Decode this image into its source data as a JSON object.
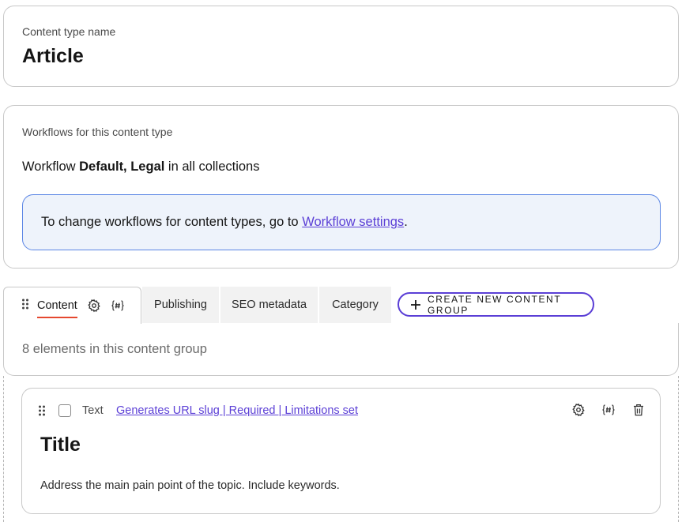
{
  "content_type": {
    "label": "Content type name",
    "name": "Article"
  },
  "workflows": {
    "label": "Workflows for this content type",
    "prefix": "Workflow",
    "names": "Default, Legal",
    "suffix": "in all collections",
    "info_text": "To change workflows for content types, go to",
    "info_link": "Workflow settings",
    "info_end": "."
  },
  "tabs": [
    {
      "label": "Content",
      "active": true
    },
    {
      "label": "Publishing",
      "active": false
    },
    {
      "label": "SEO metadata",
      "active": false
    },
    {
      "label": "Category",
      "active": false
    }
  ],
  "create_group_label": "CREATE NEW CONTENT GROUP",
  "group_count_text": "8 elements in this content group",
  "element": {
    "type": "Text",
    "properties_link": "Generates URL slug | Required | Limitations set",
    "title": "Title",
    "guidelines": "Address the main pain point of the topic. Include keywords."
  },
  "colors": {
    "accent": "#5b3fd6",
    "active_tab_underline": "#e5482f",
    "info_bg": "#eef3fb",
    "info_border": "#5b86e5"
  },
  "icons": [
    "drag-handle-icon",
    "gear-icon",
    "hash-icon",
    "plus-icon",
    "trash-icon",
    "checkbox-icon"
  ]
}
